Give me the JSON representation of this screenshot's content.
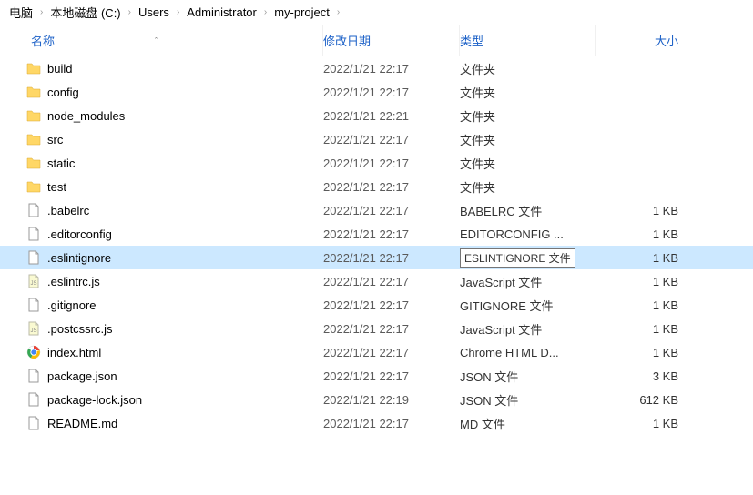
{
  "breadcrumb": {
    "items": [
      {
        "label": "﻿电脑"
      },
      {
        "label": "本地磁盘 (C:)"
      },
      {
        "label": "Users"
      },
      {
        "label": "Administrator"
      },
      {
        "label": "my-project"
      }
    ]
  },
  "columns": {
    "name": "名称",
    "date": "修改日期",
    "type": "类型",
    "size": "大小",
    "sort_indicator": "ˆ"
  },
  "tooltip": {
    "eslintignore_type": "ESLINTIGNORE 文件"
  },
  "files": [
    {
      "icon": "folder",
      "name": "build",
      "date": "2022/1/21 22:17",
      "type": "文件夹",
      "size": "",
      "selected": false
    },
    {
      "icon": "folder",
      "name": "config",
      "date": "2022/1/21 22:17",
      "type": "文件夹",
      "size": "",
      "selected": false
    },
    {
      "icon": "folder",
      "name": "node_modules",
      "date": "2022/1/21 22:21",
      "type": "文件夹",
      "size": "",
      "selected": false
    },
    {
      "icon": "folder",
      "name": "src",
      "date": "2022/1/21 22:17",
      "type": "文件夹",
      "size": "",
      "selected": false
    },
    {
      "icon": "folder",
      "name": "static",
      "date": "2022/1/21 22:17",
      "type": "文件夹",
      "size": "",
      "selected": false
    },
    {
      "icon": "folder",
      "name": "test",
      "date": "2022/1/21 22:17",
      "type": "文件夹",
      "size": "",
      "selected": false
    },
    {
      "icon": "file",
      "name": ".babelrc",
      "date": "2022/1/21 22:17",
      "type": "BABELRC 文件",
      "size": "1 KB",
      "selected": false
    },
    {
      "icon": "file",
      "name": ".editorconfig",
      "date": "2022/1/21 22:17",
      "type": "EDITORCONFIG ...",
      "size": "1 KB",
      "selected": false
    },
    {
      "icon": "file",
      "name": ".eslintignore",
      "date": "2022/1/21 22:17",
      "type": "__TOOLTIP__",
      "size": "1 KB",
      "selected": true
    },
    {
      "icon": "js",
      "name": ".eslintrc.js",
      "date": "2022/1/21 22:17",
      "type": "JavaScript 文件",
      "size": "1 KB",
      "selected": false
    },
    {
      "icon": "file",
      "name": ".gitignore",
      "date": "2022/1/21 22:17",
      "type": "GITIGNORE 文件",
      "size": "1 KB",
      "selected": false
    },
    {
      "icon": "js",
      "name": ".postcssrc.js",
      "date": "2022/1/21 22:17",
      "type": "JavaScript 文件",
      "size": "1 KB",
      "selected": false
    },
    {
      "icon": "chrome",
      "name": "index.html",
      "date": "2022/1/21 22:17",
      "type": "Chrome HTML D...",
      "size": "1 KB",
      "selected": false
    },
    {
      "icon": "file",
      "name": "package.json",
      "date": "2022/1/21 22:17",
      "type": "JSON 文件",
      "size": "3 KB",
      "selected": false
    },
    {
      "icon": "file",
      "name": "package-lock.json",
      "date": "2022/1/21 22:19",
      "type": "JSON 文件",
      "size": "612 KB",
      "selected": false
    },
    {
      "icon": "file",
      "name": "README.md",
      "date": "2022/1/21 22:17",
      "type": "MD 文件",
      "size": "1 KB",
      "selected": false
    }
  ]
}
